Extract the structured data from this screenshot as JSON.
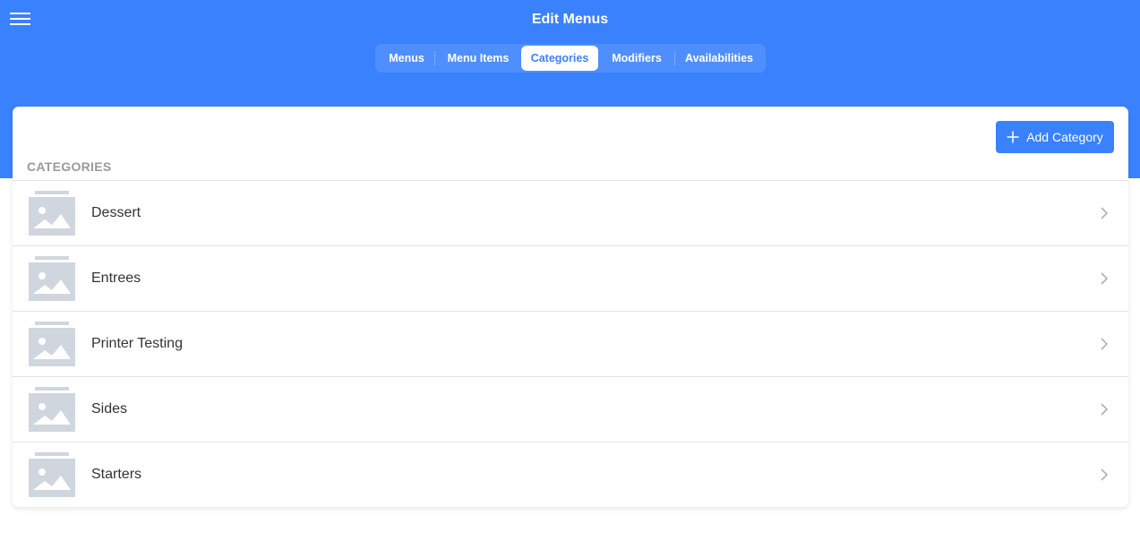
{
  "header": {
    "title": "Edit Menus",
    "tabs": [
      {
        "label": "Menus",
        "active": false
      },
      {
        "label": "Menu Items",
        "active": false
      },
      {
        "label": "Categories",
        "active": true
      },
      {
        "label": "Modifiers",
        "active": false
      },
      {
        "label": "Availabilities",
        "active": false
      }
    ]
  },
  "content": {
    "add_button_label": "Add Category",
    "section_label": "CATEGORIES",
    "categories": [
      {
        "label": "Dessert"
      },
      {
        "label": "Entrees"
      },
      {
        "label": "Printer Testing"
      },
      {
        "label": "Sides"
      },
      {
        "label": "Starters"
      }
    ]
  },
  "colors": {
    "primary": "#3a81fd",
    "placeholder": "#d0d6de",
    "label_gray": "#9a9a9a"
  },
  "icons": {
    "menu": "hamburger-icon",
    "add": "plus-icon",
    "thumb": "image-placeholder-icon",
    "row_action": "chevron-right-icon"
  }
}
